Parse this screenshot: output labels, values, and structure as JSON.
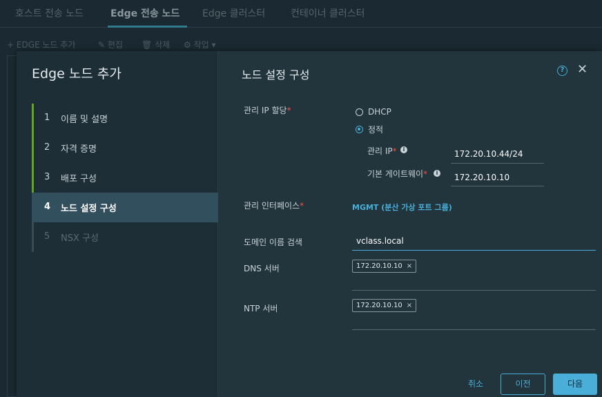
{
  "tabs": [
    {
      "label": "호스트 전송 노드"
    },
    {
      "label": "Edge 전송 노드"
    },
    {
      "label": "Edge 클러스터"
    },
    {
      "label": "컨테이너 클러스터"
    }
  ],
  "toolbar": {
    "add_label": "EDGE 노드 추가",
    "edit_label": "편집",
    "delete_label": "삭제",
    "actions_label": "작업"
  },
  "wizard": {
    "title": "Edge 노드 추가",
    "steps": [
      {
        "num": "1",
        "label": "이름 및 설명",
        "state": "done"
      },
      {
        "num": "2",
        "label": "자격 증명",
        "state": "done"
      },
      {
        "num": "3",
        "label": "배포 구성",
        "state": "done"
      },
      {
        "num": "4",
        "label": "노드 설정 구성",
        "state": "current"
      },
      {
        "num": "5",
        "label": "NSX 구성",
        "state": "disabled"
      }
    ]
  },
  "form": {
    "title": "노드 설정 구성",
    "mgmt_ip_alloc_label": "관리 IP 할당",
    "option_dhcp": "DHCP",
    "option_static": "정적",
    "selected_option": "정적",
    "mgmt_ip_label": "관리 IP",
    "mgmt_ip_value": "172.20.10.44/24",
    "gateway_label": "기본 게이트웨이",
    "gateway_value": "172.20.10.10",
    "mgmt_interface_label": "관리 인터페이스",
    "mgmt_interface_value": "MGMT (분산 가상 포트 그룹)",
    "domain_search_label": "도메인 이름 검색",
    "domain_search_value": "vclass.local",
    "dns_label": "DNS 서버",
    "dns_servers": [
      "172.20.10.10"
    ],
    "ntp_label": "NTP 서버",
    "ntp_servers": [
      "172.20.10.10"
    ]
  },
  "footer": {
    "cancel_label": "취소",
    "back_label": "이전",
    "next_label": "다음"
  },
  "colors": {
    "accent": "#49afd9",
    "step_done": "#62a420",
    "required": "#f54f47"
  },
  "icons": {
    "help": "help-circle-icon",
    "close": "close-icon",
    "info": "info-icon",
    "remove_chip": "remove-icon"
  }
}
